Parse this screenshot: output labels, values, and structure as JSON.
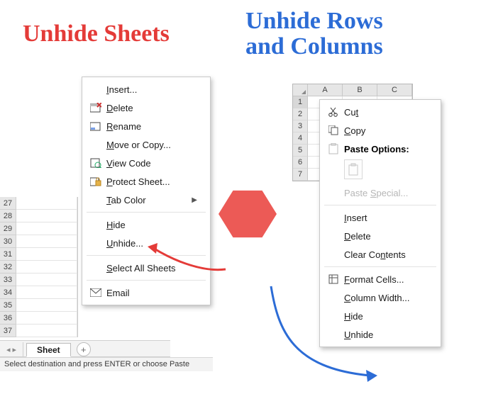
{
  "titles": {
    "left": "Unhide Sheets",
    "right_line1": "Unhide Rows",
    "right_line2": "and Columns"
  },
  "left_rows": [
    27,
    28,
    29,
    30,
    31,
    32,
    33,
    34,
    35,
    36,
    37
  ],
  "sheet_tab": "Sheet",
  "statusbar": "Select destination and press ENTER or choose Paste",
  "right_cols": [
    "A",
    "B",
    "C"
  ],
  "right_rows": [
    1,
    2,
    3,
    4,
    5,
    6,
    7
  ],
  "menu_left": {
    "insert": "Insert...",
    "delete": "Delete",
    "rename": "Rename",
    "move": "Move or Copy...",
    "view_code": "View Code",
    "protect": "Protect Sheet...",
    "tab_color": "Tab Color",
    "hide": "Hide",
    "unhide": "Unhide...",
    "select_all": "Select All Sheets",
    "email": "Email"
  },
  "menu_right": {
    "cut": "Cut",
    "copy": "Copy",
    "paste_options": "Paste Options:",
    "paste_special": "Paste Special...",
    "insert": "Insert",
    "delete": "Delete",
    "clear": "Clear Contents",
    "format_cells": "Format Cells...",
    "col_width": "Column Width...",
    "hide": "Hide",
    "unhide": "Unhide"
  }
}
